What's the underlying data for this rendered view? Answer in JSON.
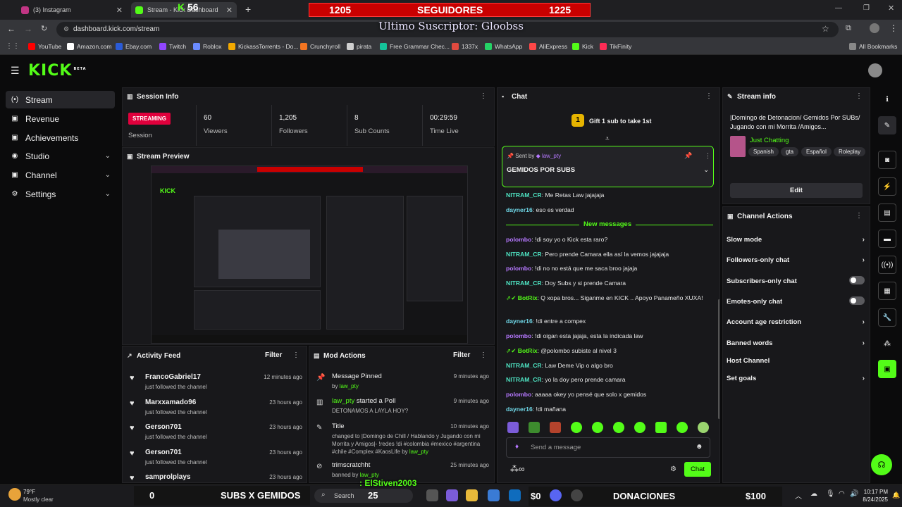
{
  "browser": {
    "tabs": [
      {
        "label": "(3) Instagram",
        "color": "#c13584"
      },
      {
        "label": "Stream - Kick Dashboard",
        "color": "#53fc18"
      }
    ],
    "counter_overlay": "56",
    "url": "dashboard.kick.com/stream",
    "bookmarks": [
      {
        "label": "YouTube",
        "color": "#ff0000"
      },
      {
        "label": "Amazon.com",
        "color": "#ffffff"
      },
      {
        "label": "Ebay.com",
        "color": "#2a5bd7"
      },
      {
        "label": "Twitch",
        "color": "#9146ff"
      },
      {
        "label": "Roblox",
        "color": "#6b8cff"
      },
      {
        "label": "KickassTorrents - Do...",
        "color": "#f2a900"
      },
      {
        "label": "Crunchyroll",
        "color": "#f47521"
      },
      {
        "label": "pirata",
        "color": "#cfcfcf"
      },
      {
        "label": "Free Grammar Chec...",
        "color": "#15c39a"
      },
      {
        "label": "1337x",
        "color": "#e04a3f"
      },
      {
        "label": "WhatsApp",
        "color": "#25d366"
      },
      {
        "label": "AliExpress",
        "color": "#ff4747"
      },
      {
        "label": "Kick",
        "color": "#53fc18"
      },
      {
        "label": "TikFinity",
        "color": "#fe2c55"
      }
    ],
    "all_bookmarks": "All Bookmarks"
  },
  "overlay": {
    "followers_left": "1205",
    "followers_label": "SEGUIDORES",
    "followers_right": "1225",
    "last_sub": "Ultimo Suscriptor: Gloobss",
    "subs_left": "0",
    "subs_label": "SUBS X GEMIDOS",
    "subs_right": "25",
    "latest_name": ": ElStiven2003",
    "don_left": "$0",
    "don_label": "DONACIONES",
    "don_right": "$100"
  },
  "app": {
    "logo": "KICK",
    "logo_tag": "BETA",
    "accent": "#53fc18"
  },
  "sidebar": {
    "items": [
      {
        "label": "Stream",
        "icon": "broadcast-icon",
        "glyph": "(•)",
        "chev": ""
      },
      {
        "label": "Revenue",
        "icon": "dollar-icon",
        "glyph": "▣",
        "chev": ""
      },
      {
        "label": "Achievements",
        "icon": "trophy-icon",
        "glyph": "▣",
        "chev": ""
      },
      {
        "label": "Studio",
        "icon": "studio-icon",
        "glyph": "◉",
        "chev": "⌄"
      },
      {
        "label": "Channel",
        "icon": "channel-icon",
        "glyph": "▣",
        "chev": "⌄"
      },
      {
        "label": "Settings",
        "icon": "gear-icon",
        "glyph": "⚙",
        "chev": "⌄"
      }
    ]
  },
  "session": {
    "title": "Session Info",
    "badge": "STREAMING",
    "session_label": "Session",
    "stats": [
      {
        "value": "60",
        "label": "Viewers"
      },
      {
        "value": "1,205",
        "label": "Followers"
      },
      {
        "value": "8",
        "label": "Sub Counts"
      },
      {
        "value": "00:29:59",
        "label": "Time Live"
      }
    ]
  },
  "preview": {
    "title": "Stream Preview"
  },
  "activity": {
    "title": "Activity Feed",
    "filter": "Filter",
    "items": [
      {
        "name": "FrancoGabriel17",
        "sub": "just followed the channel",
        "time": "12 minutes ago"
      },
      {
        "name": "Marxxamado96",
        "sub": "just followed the channel",
        "time": "23 hours ago"
      },
      {
        "name": "Gerson701",
        "sub": "just followed the channel",
        "time": "23 hours ago"
      },
      {
        "name": "Gerson701",
        "sub": "just followed the channel",
        "time": "23 hours ago"
      },
      {
        "name": "samprolplays",
        "sub": "",
        "time": "23 hours ago"
      }
    ]
  },
  "modactions": {
    "title": "Mod Actions",
    "filter": "Filter",
    "items": [
      {
        "title": "Message Pinned",
        "by": "by",
        "user": "law_pty",
        "time": "9 minutes ago"
      },
      {
        "title_user": "law_pty",
        "title_rest": " started a Poll",
        "sub": "DETONAMOS A LAYLA HOY?",
        "time": "9 minutes ago"
      },
      {
        "title": "Title",
        "sub1": "changed to |Domingo de Chill / Hablando y Jugando con mi Morrita y Amigos|- !redes !di #colombia #mexico #argentina #chile #Complex #KaosLife",
        "by": "by",
        "user": "law_pty",
        "time": "10 minutes ago"
      },
      {
        "title": "trimscratchht",
        "sub": "banned by",
        "user": "law_pty",
        "time": "25 minutes ago"
      }
    ]
  },
  "chat": {
    "title": "Chat",
    "gift": "Gift 1 sub to take 1st",
    "gift_count": "1",
    "pinned_by": "Sent by",
    "pinned_user": "law_pty",
    "pinned_text": "GEMIDOS POR SUBS",
    "new_messages": "New messages",
    "messages": [
      {
        "user": "NITRAM_CR",
        "cls": "u4",
        "text": ": Me Retas Law jajajaja"
      },
      {
        "user": "dayner16",
        "cls": "u1",
        "text": ": eso es verdad"
      },
      {
        "user": "polombo",
        "cls": "u2",
        "text": ": !di soy yo o Kick esta raro?"
      },
      {
        "user": "NITRAM_CR",
        "cls": "u4",
        "text": ": Pero prende Camara ella así la vemos jajajaja"
      },
      {
        "user": "polombo",
        "cls": "u2",
        "text": ": !di no no está que me saca broo jajaja"
      },
      {
        "user": "NITRAM_CR",
        "cls": "u4",
        "text": ": Doy Subs y si prende Camara"
      },
      {
        "user": "BotRix",
        "cls": "u3",
        "text": ": Q xopa bros... Siganme en KICK .. Apoyo Panameño XUXA!"
      },
      {
        "user": "dayner16",
        "cls": "u1",
        "text": ": !di entre a compex"
      },
      {
        "user": "polombo",
        "cls": "u2",
        "text": ": !di oigan esta jajaja, esta la indicada law"
      },
      {
        "user": "BotRix",
        "cls": "u3",
        "text": ": @polombo subiste al nivel 3"
      },
      {
        "user": "NITRAM_CR",
        "cls": "u4",
        "text": ": Law Deme Vip o algo bro"
      },
      {
        "user": "NITRAM_CR",
        "cls": "u4",
        "text": ": yo la doy pero prende camara"
      },
      {
        "user": "polombo",
        "cls": "u2",
        "text": ": aaaaa okey yo pensé que solo x gemidos"
      },
      {
        "user": "dayner16",
        "cls": "u1",
        "text": ": !di mañana"
      }
    ],
    "input_placeholder": "Send a message",
    "send": "Chat"
  },
  "streaminfo": {
    "title": "Stream info",
    "stream_title": "|Domingo de Detonacion/ Gemidos Por SUBs/ Jugando con mi Morrita /Amigos...",
    "category": "Just Chatting",
    "tags": [
      "Spanish",
      "gta",
      "Español",
      "Roleplay"
    ],
    "edit": "Edit"
  },
  "channelactions": {
    "title": "Channel Actions",
    "items": [
      {
        "label": "Slow mode",
        "kind": "chev"
      },
      {
        "label": "Followers-only chat",
        "kind": "chev"
      },
      {
        "label": "Subscribers-only chat",
        "kind": "toggle"
      },
      {
        "label": "Emotes-only chat",
        "kind": "toggle"
      },
      {
        "label": "Account age restriction",
        "kind": "chev"
      },
      {
        "label": "Banned words",
        "kind": "chev"
      },
      {
        "label": "Host Channel",
        "kind": "none"
      },
      {
        "label": "Set goals",
        "kind": "chev"
      }
    ]
  },
  "taskbar": {
    "weather_temp": "79°F",
    "weather_desc": "Mostly clear",
    "search": "Search",
    "time": "10:17 PM",
    "date": "8/24/2025"
  }
}
